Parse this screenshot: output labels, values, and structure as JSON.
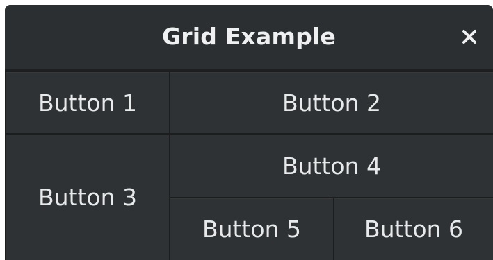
{
  "window": {
    "title": "Grid Example",
    "close_icon": "close-icon"
  },
  "grid": {
    "buttons": [
      {
        "label": "Button 1"
      },
      {
        "label": "Button 2"
      },
      {
        "label": "Button 3"
      },
      {
        "label": "Button 4"
      },
      {
        "label": "Button 5"
      },
      {
        "label": "Button 6"
      }
    ]
  },
  "colors": {
    "background": "#2b2e30",
    "button": "#2f3234",
    "border": "#1b1d1e",
    "text": "#e7e9ea"
  }
}
